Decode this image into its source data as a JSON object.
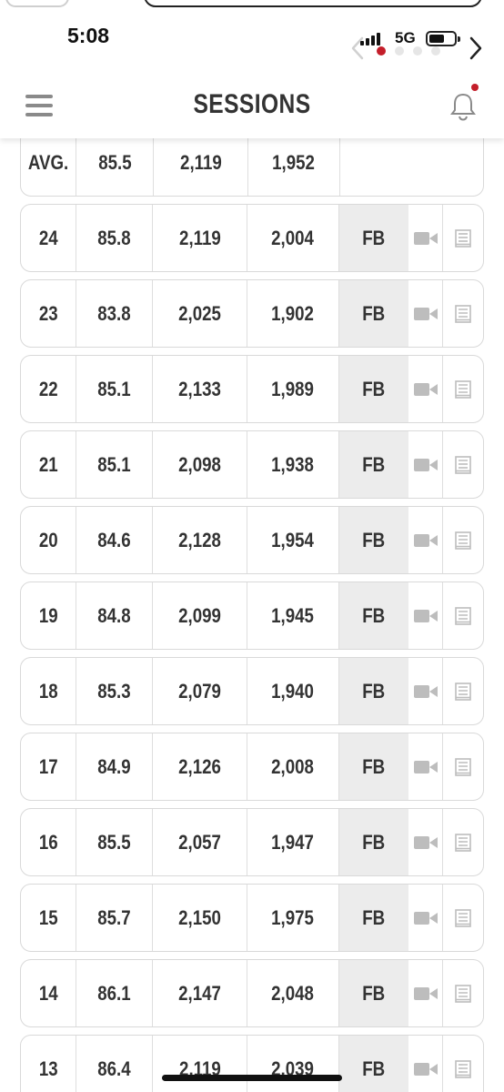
{
  "status_bar": {
    "time": "5:08",
    "network": "5G"
  },
  "header": {
    "title": "SESSIONS"
  },
  "colors": {
    "accent": "#c41e2a",
    "text": "#333333",
    "shaded_cell": "#ececec",
    "icon_gray": "#bdbdbd"
  },
  "icons": {
    "menu": "hamburger-icon",
    "notifications": "bell-icon",
    "video": "video-camera-icon",
    "notes": "notes-icon"
  },
  "avg_row": {
    "label": "AVG.",
    "v1": "85.5",
    "v2": "2,119",
    "v3": "1,952"
  },
  "sessions": [
    {
      "num": "24",
      "v1": "85.8",
      "v2": "2,119",
      "v3": "2,004",
      "tag": "FB"
    },
    {
      "num": "23",
      "v1": "83.8",
      "v2": "2,025",
      "v3": "1,902",
      "tag": "FB"
    },
    {
      "num": "22",
      "v1": "85.1",
      "v2": "2,133",
      "v3": "1,989",
      "tag": "FB"
    },
    {
      "num": "21",
      "v1": "85.1",
      "v2": "2,098",
      "v3": "1,938",
      "tag": "FB"
    },
    {
      "num": "20",
      "v1": "84.6",
      "v2": "2,128",
      "v3": "1,954",
      "tag": "FB"
    },
    {
      "num": "19",
      "v1": "84.8",
      "v2": "2,099",
      "v3": "1,945",
      "tag": "FB"
    },
    {
      "num": "18",
      "v1": "85.3",
      "v2": "2,079",
      "v3": "1,940",
      "tag": "FB"
    },
    {
      "num": "17",
      "v1": "84.9",
      "v2": "2,126",
      "v3": "2,008",
      "tag": "FB"
    },
    {
      "num": "16",
      "v1": "85.5",
      "v2": "2,057",
      "v3": "1,947",
      "tag": "FB"
    },
    {
      "num": "15",
      "v1": "85.7",
      "v2": "2,150",
      "v3": "1,975",
      "tag": "FB"
    },
    {
      "num": "14",
      "v1": "86.1",
      "v2": "2,147",
      "v3": "2,048",
      "tag": "FB"
    },
    {
      "num": "13",
      "v1": "86.4",
      "v2": "2,119",
      "v3": "2,039",
      "tag": "FB"
    }
  ]
}
